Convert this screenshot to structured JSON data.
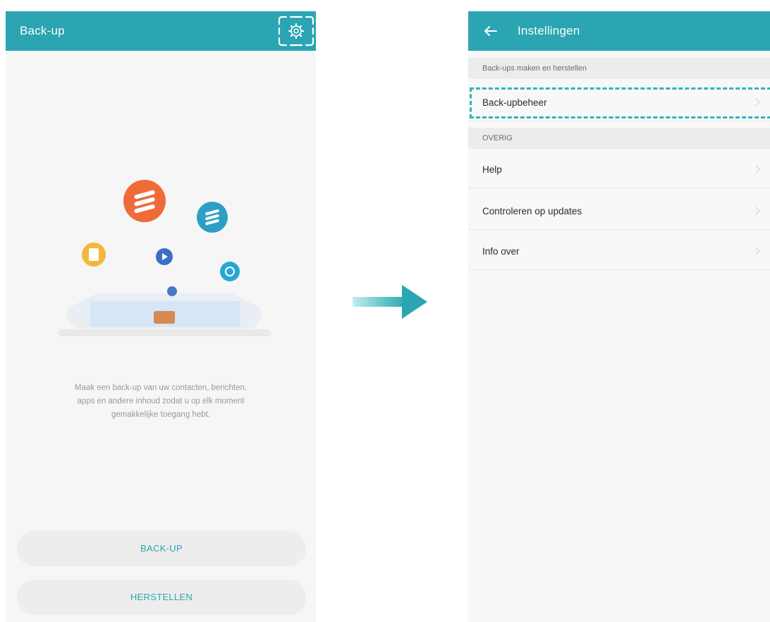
{
  "left_screen": {
    "title": "Back-up",
    "settings_icon": "gear-icon",
    "description_lines": [
      "Maak een back-up van uw contacten, berichten,",
      "apps en andere inhoud zodat u op elk moment",
      "gemakkelijke toegang hebt."
    ],
    "buttons": {
      "backup": "BACK-UP",
      "restore": "HERSTELLEN"
    }
  },
  "right_screen": {
    "title": "Instellingen",
    "back_icon": "arrow-left-icon",
    "sections": [
      {
        "header": "Back-ups maken en herstellen",
        "items": [
          {
            "label": "Back-upbeheer",
            "highlighted": true
          }
        ]
      },
      {
        "header": "OVERIG",
        "items": [
          {
            "label": "Help"
          },
          {
            "label": "Controleren op updates"
          },
          {
            "label": "Info over"
          }
        ]
      }
    ]
  },
  "colors": {
    "accent": "#2aa5b1",
    "highlight_dash": "#2fb4b8",
    "background": "#f6f6f6",
    "orange": "#ef6b3a",
    "blue": "#2e9fc4",
    "yellow": "#f3b73b"
  }
}
